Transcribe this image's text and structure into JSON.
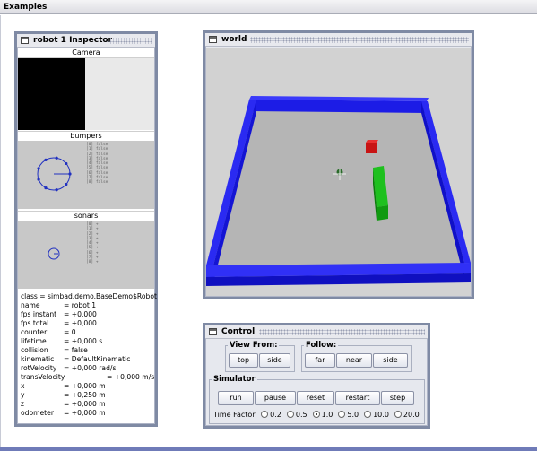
{
  "app": {
    "title": "Examples"
  },
  "inspector": {
    "title": "robot 1 Inspector",
    "camera_label": "Camera",
    "bumpers_label": "bumpers",
    "bumpers_values": [
      "[0] false",
      "[1] false",
      "[2] false",
      "[3] false",
      "[4] false",
      "[5] false",
      "[6] false",
      "[7] false",
      "[8] false"
    ],
    "sonars_label": "sonars",
    "sonars_values": [
      "[0] +",
      "[1] +",
      "[2] +",
      "[3] +",
      "[4] +",
      "[5] +",
      "[6] +",
      "[7] +",
      "[8] +"
    ],
    "properties": [
      {
        "key": "class = simbad.demo.BaseDemo$Robot",
        "value": ""
      },
      {
        "key": "name",
        "value": "= robot 1"
      },
      {
        "key": "fps instant",
        "value": "= +0,000"
      },
      {
        "key": "fps total",
        "value": "= +0,000"
      },
      {
        "key": "counter",
        "value": "= 0"
      },
      {
        "key": "lifetime",
        "value": "= +0,000 s"
      },
      {
        "key": "collision",
        "value": "= false"
      },
      {
        "key": "kinematic",
        "value": "= DefaultKinematic"
      },
      {
        "key": "rotVelocity",
        "value": "= +0,000 rad/s"
      },
      {
        "key": "transVelocity",
        "value": "= +0,000 m/s",
        "wide": true
      },
      {
        "key": "x",
        "value": "= +0,000 m"
      },
      {
        "key": "y",
        "value": "= +0,250 m"
      },
      {
        "key": "z",
        "value": "= +0,000 m"
      },
      {
        "key": "odometer",
        "value": "= +0,000 m"
      }
    ]
  },
  "world": {
    "title": "world"
  },
  "control": {
    "title": "Control",
    "view_from_label": "View From:",
    "view_buttons": [
      "top",
      "side"
    ],
    "follow_label": "Follow:",
    "follow_buttons": [
      "far",
      "near",
      "side"
    ],
    "simulator_label": "Simulator",
    "sim_buttons": [
      "run",
      "pause",
      "reset",
      "restart",
      "step"
    ],
    "time_factor_label": "Time Factor",
    "time_factors": [
      "0.2",
      "0.5",
      "1.0",
      "5.0",
      "10.0",
      "20.0"
    ],
    "selected_time_factor": "1.0"
  },
  "colors": {
    "wall": "#1414e0",
    "green_box": "#10b010",
    "red_box": "#c81010",
    "floor": "#b4b4b4",
    "frame_border": "#7f8aa4"
  }
}
